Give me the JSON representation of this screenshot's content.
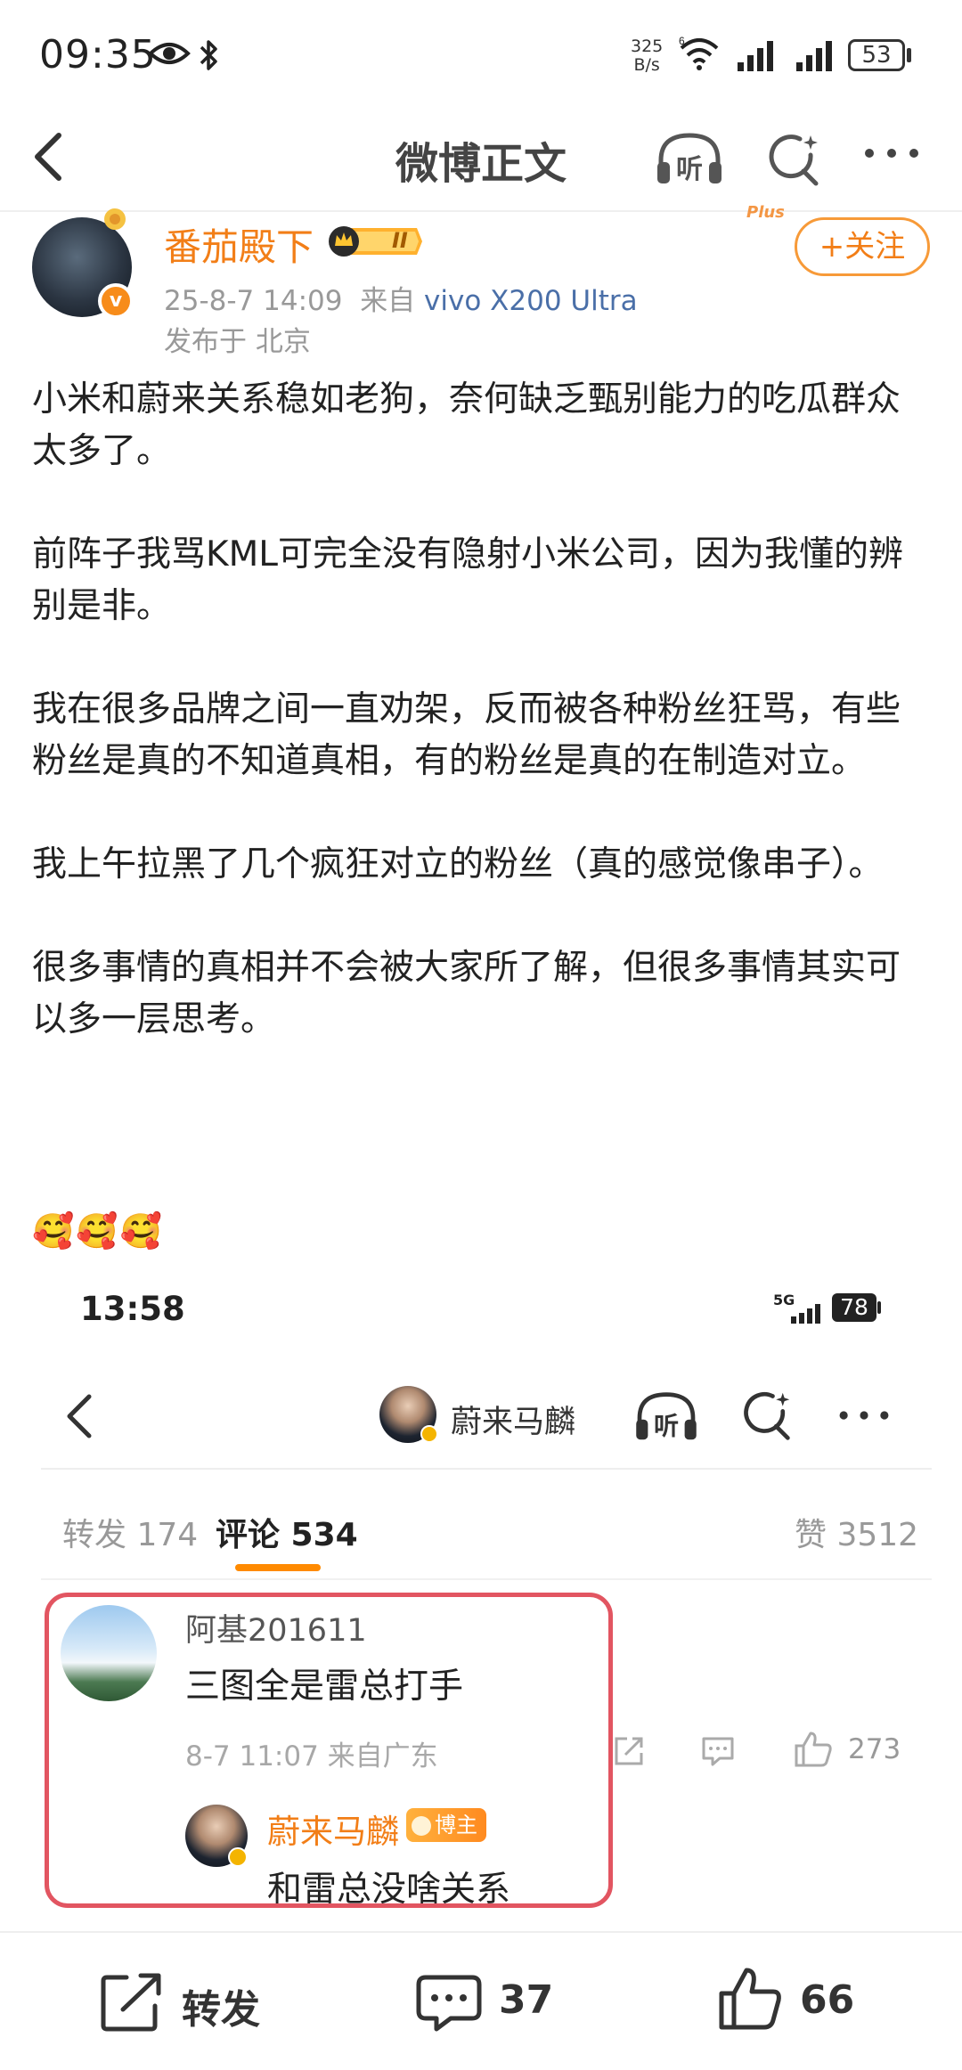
{
  "status_bar": {
    "time": "09:35",
    "net_speed_value": "325",
    "net_speed_unit": "B/s",
    "battery": "53"
  },
  "header": {
    "title": "微博正文",
    "listen_icon": "headphones-listen-icon",
    "search_icon": "sparkle-search-icon",
    "more_icon": "more-dots-icon"
  },
  "post": {
    "author": "番茄殿下",
    "level_badge": "II",
    "follow_label": "+关注",
    "plus_deco": "Plus",
    "date": "25-8-7 14:09",
    "from_label": "来自",
    "source": "vivo X200 Ultra",
    "location": "发布于 北京",
    "paragraphs": [
      "小米和蔚来关系稳如老狗，奈何缺乏甄别能力的吃瓜群众太多了。",
      "前阵子我骂KML可完全没有隐射小米公司，因为我懂的辨别是非。",
      "我在很多品牌之间一直劝架，反而被各种粉丝狂骂，有些粉丝是真的不知道真相，有的粉丝是真的在制造对立。",
      "我上午拉黑了几个疯狂对立的粉丝（真的感觉像串子）。",
      "很多事情的真相并不会被大家所了解，但很多事情其实可以多一层思考。"
    ],
    "emojis": "🥰🥰🥰"
  },
  "embedded": {
    "time": "13:58",
    "network": "5G",
    "battery": "78",
    "account_name": "蔚来马麟",
    "tabs": {
      "repost": "转发 174",
      "comments": "评论 534",
      "likes": "赞 3512"
    },
    "comment": {
      "user": "阿基201611",
      "text": "三图全是雷总打手",
      "meta": "8-7 11:07 来自广东",
      "likes": "273",
      "reply": {
        "user": "蔚来马麟",
        "badge": "博主",
        "text": "和雷总没啥关系"
      }
    }
  },
  "bottom_bar": {
    "repost_label": "转发",
    "comment_count": "37",
    "like_count": "66"
  },
  "colors": {
    "accent": "#f27e17",
    "highlight_border": "#e25561",
    "link": "#4a6fa8"
  }
}
